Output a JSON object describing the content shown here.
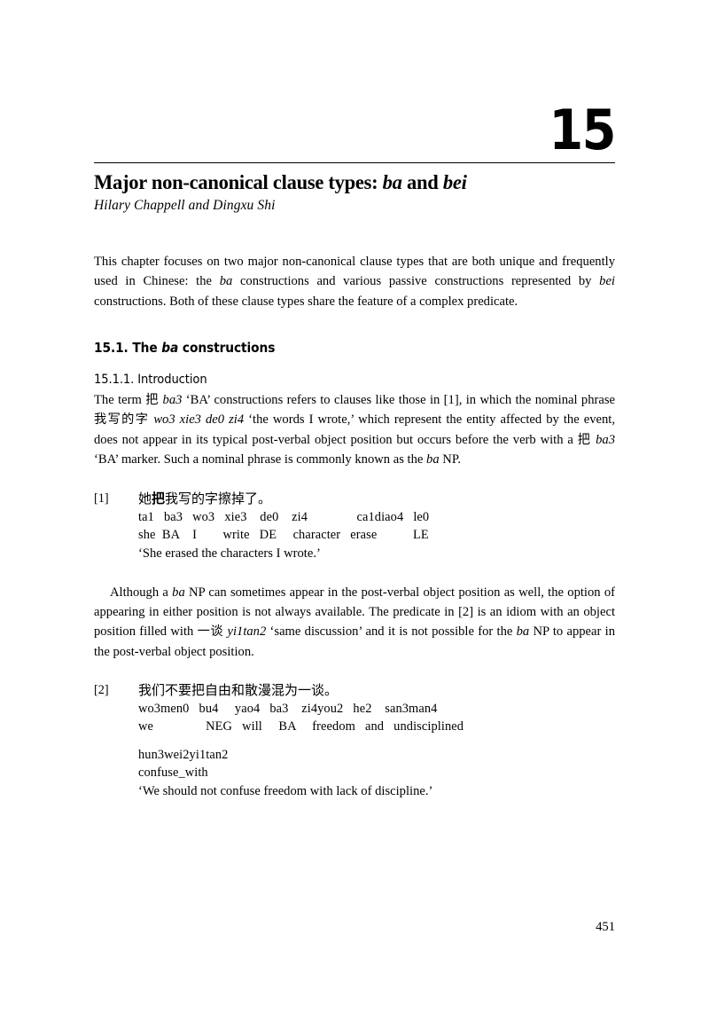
{
  "chapter": {
    "number": "15",
    "title_before": "Major non-canonical clause types: ",
    "title_italic_1": "ba",
    "title_mid": " and ",
    "title_italic_2": "bei",
    "authors": "Hilary Chappell and Dingxu Shi"
  },
  "abstract": {
    "part1": "This chapter focuses on two major non-canonical clause types that are both unique and frequently used in Chinese: the ",
    "italic1": "ba",
    "part2": " constructions and various passive construc­tions represented by ",
    "italic2": "bei",
    "part3": " constructions. Both of these clause types share the feature of a complex predicate."
  },
  "sections": {
    "s1_num": "15.1. ",
    "s1_the": "The ",
    "s1_italic": "ba",
    "s1_rest": " constructions",
    "s11": "15.1.1. Introduction"
  },
  "para_intro": {
    "p1": "The term ",
    "cn1": "把",
    "p2": " ",
    "it1": "ba3",
    "p3": " ‘BA’ constructions refers to clauses like those in [1], in which the nominal phrase ",
    "cn2": "我写的字",
    "p4": " ",
    "it2": "wo3 xie3 de0 zi4",
    "p5": " ‘the words I wrote,’ which represent the entity affected by the event, does not appear in its typical post-verbal object position but occurs before the verb with a ",
    "cn3": "把",
    "p6": " ",
    "it3": "ba3",
    "p7": " ‘BA’ marker. Such a nominal phrase is commonly known as the ",
    "it4": "ba",
    "p8": " NP."
  },
  "para_middle": {
    "p1": "Although a ",
    "it1": "ba",
    "p2": " NP can sometimes appear in the post-verbal object position as well, the option of appearing in either position is not always available. The pred­icate in [2] is an idiom with an object position filled with ",
    "cn1": "一谈",
    "p3": " ",
    "it2": "yi1tan2",
    "p4": " ‘same discussion’ and it is not possible for the ",
    "it3": "ba",
    "p5": " NP to appear in the post-verbal object position."
  },
  "example1": {
    "number": "[1]",
    "chinese_pre": "她",
    "chinese_bold": "把",
    "chinese_post": "我写的字擦掉了。",
    "transliteration": "ta1   ba3   wo3   xie3    de0    zi4               ca1diao4   le0",
    "gloss": "she  BA    I        write   DE     character   erase           LE",
    "translation": "‘She erased the characters I wrote.’"
  },
  "example2": {
    "number": "[2]",
    "chinese": "我们不要把自由和散漫混为一谈。",
    "transliteration": "wo3men0   bu4     yao4   ba3    zi4you2   he2    san3man4",
    "gloss": "we                NEG   will     BA     freedom   and   undisciplined",
    "transliteration2": "hun3wei2yi1tan2",
    "gloss2": "confuse_with",
    "translation": "‘We should not confuse freedom with lack of discipline.’"
  },
  "folio": {
    "page_number": "451"
  }
}
